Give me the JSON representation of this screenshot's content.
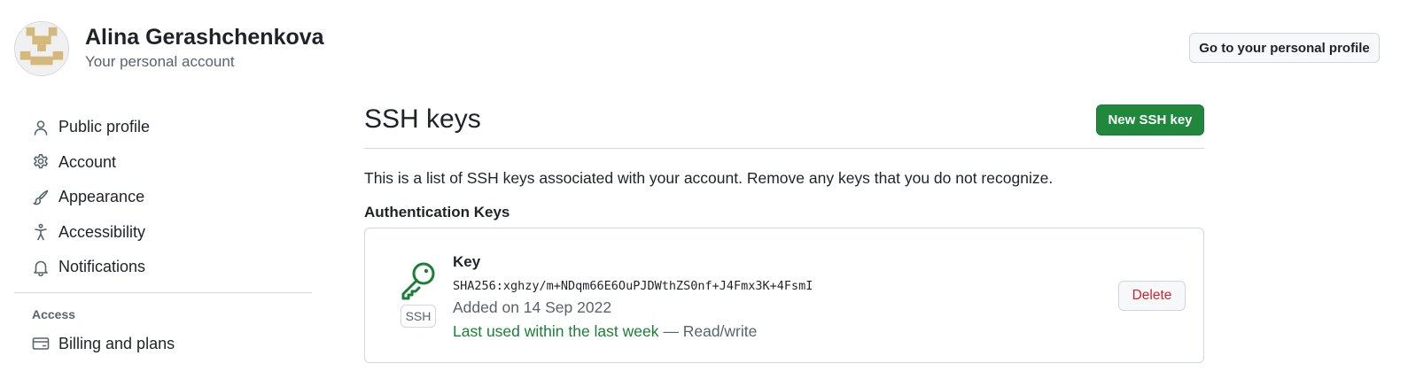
{
  "header": {
    "user_name": "Alina Gerashchenkova",
    "user_subtitle": "Your personal account",
    "profile_button": "Go to your personal profile"
  },
  "sidebar": {
    "items": [
      {
        "label": "Public profile",
        "icon": "person-icon"
      },
      {
        "label": "Account",
        "icon": "gear-icon"
      },
      {
        "label": "Appearance",
        "icon": "paintbrush-icon"
      },
      {
        "label": "Accessibility",
        "icon": "accessibility-icon"
      },
      {
        "label": "Notifications",
        "icon": "bell-icon"
      }
    ],
    "access_heading": "Access",
    "access_items": [
      {
        "label": "Billing and plans",
        "icon": "credit-card-icon"
      }
    ]
  },
  "main": {
    "title": "SSH keys",
    "new_button": "New SSH key",
    "description": "This is a list of SSH keys associated with your account. Remove any keys that you do not recognize.",
    "section_title": "Authentication Keys",
    "key": {
      "type_label": "SSH",
      "title": "Key",
      "fingerprint": "SHA256:xghzy/m+NDqm66E6OuPJDWthZS0nf+J4Fmx3K+4FsmI",
      "added": "Added on 14 Sep 2022",
      "last_used": "Last used within the last week",
      "access": " — Read/write",
      "delete_button": "Delete"
    }
  },
  "colors": {
    "primary_green": "#1f883d",
    "success_text": "#1a7f37",
    "danger": "#d1242f",
    "border": "#d0d7de",
    "avatar_gold": "#d4b97a"
  }
}
